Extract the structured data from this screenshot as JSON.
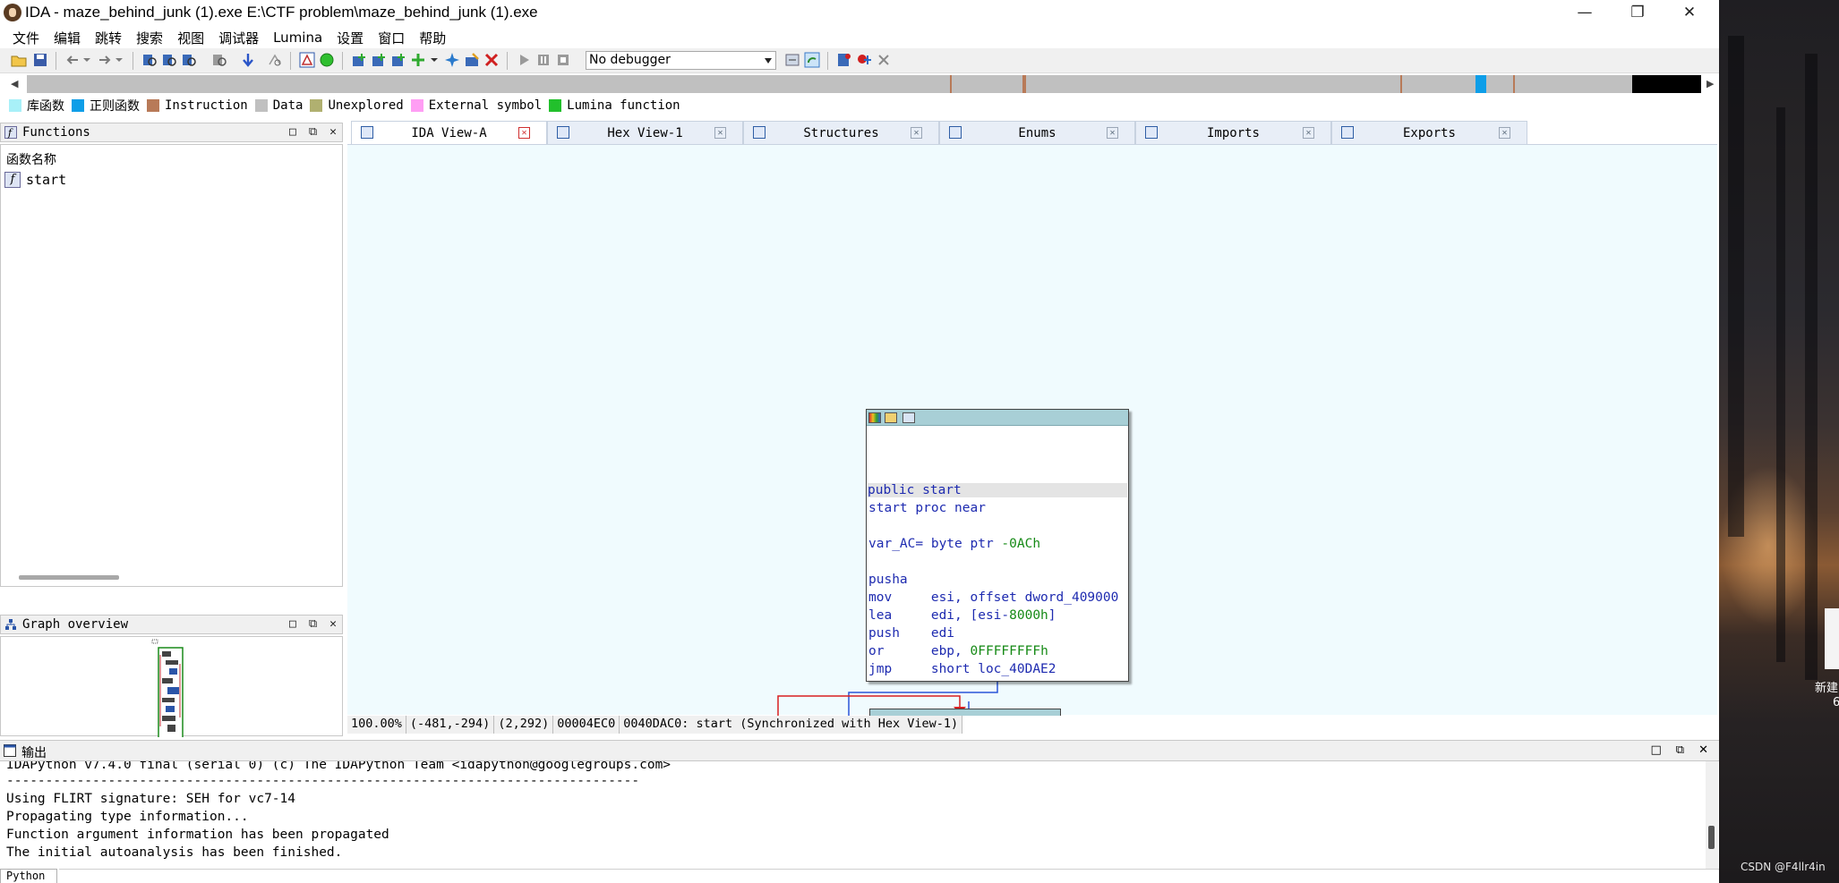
{
  "window": {
    "title": "IDA - maze_behind_junk (1).exe E:\\CTF problem\\maze_behind_junk (1).exe",
    "minimize_glyph": "—",
    "maximize_glyph": "❐",
    "close_glyph": "✕"
  },
  "menu": [
    "文件",
    "编辑",
    "跳转",
    "搜索",
    "视图",
    "调试器",
    "Lumina",
    "设置",
    "窗口",
    "帮助"
  ],
  "toolbar": {
    "debugger_selected": "No debugger"
  },
  "legend": [
    {
      "label": "库函数",
      "color": "#a8f0f8"
    },
    {
      "label": "正则函数",
      "color": "#0e9ee8"
    },
    {
      "label": "Instruction",
      "color": "#b87a58"
    },
    {
      "label": "Data",
      "color": "#c0c0c0"
    },
    {
      "label": "Unexplored",
      "color": "#b0b070"
    },
    {
      "label": "External symbol",
      "color": "#ff9ef4"
    },
    {
      "label": "Lumina function",
      "color": "#22c02c"
    }
  ],
  "functions_panel": {
    "title": "Functions",
    "column_header": "函数名称",
    "items": [
      "start"
    ],
    "icon_letter": "f"
  },
  "graph_overview": {
    "title": "Graph overview"
  },
  "panel_buttons": {
    "restore": "□",
    "float": "⧉",
    "close": "✕"
  },
  "tabs": [
    {
      "label": "IDA View-A",
      "active": true
    },
    {
      "label": "Hex View-1",
      "active": false
    },
    {
      "label": "Structures",
      "active": false
    },
    {
      "label": "Enums",
      "active": false
    },
    {
      "label": "Imports",
      "active": false
    },
    {
      "label": "Exports",
      "active": false
    }
  ],
  "tab_close_glyph": "✕",
  "graph_node": {
    "lines": [
      {
        "text": "public start",
        "highlight": true
      },
      {
        "text": "start proc near"
      },
      {
        "text": ""
      },
      {
        "text": "var_AC= byte ptr ",
        "num": "-0ACh"
      },
      {
        "text": ""
      },
      {
        "text": "pusha"
      },
      {
        "text": "mov     esi, offset dword_409000"
      },
      {
        "text": "lea     edi, [esi-",
        "num": "8000h",
        "tail": "]"
      },
      {
        "text": "push    edi"
      },
      {
        "text": "or      ebp, ",
        "num": "0FFFFFFFFh"
      },
      {
        "text": "jmp     short loc_40DAE2"
      }
    ]
  },
  "status": {
    "zoom": "100.00%",
    "mouse": "(-481,-294)",
    "coords": "(2,292)",
    "offset": "00004EC0",
    "location": "0040DAC0: start (Synchronized with Hex View-1)"
  },
  "output": {
    "title": "输出",
    "lines": [
      "IDAPython v7.4.0 final (serial 0) (c) The IDAPython Team <idapython@googlegroups.com>",
      "---------------------------------------------------------------------------------",
      "Using FLIRT signature: SEH for vc7-14",
      "Propagating type information...",
      "Function argument information has been propagated",
      "The initial autoanalysis has been finished."
    ],
    "interpreter_tab": "Python"
  },
  "desktop": {
    "icon_label_1": "新建",
    "icon_label_2": "6",
    "watermark": "CSDN @F4llr4in"
  }
}
